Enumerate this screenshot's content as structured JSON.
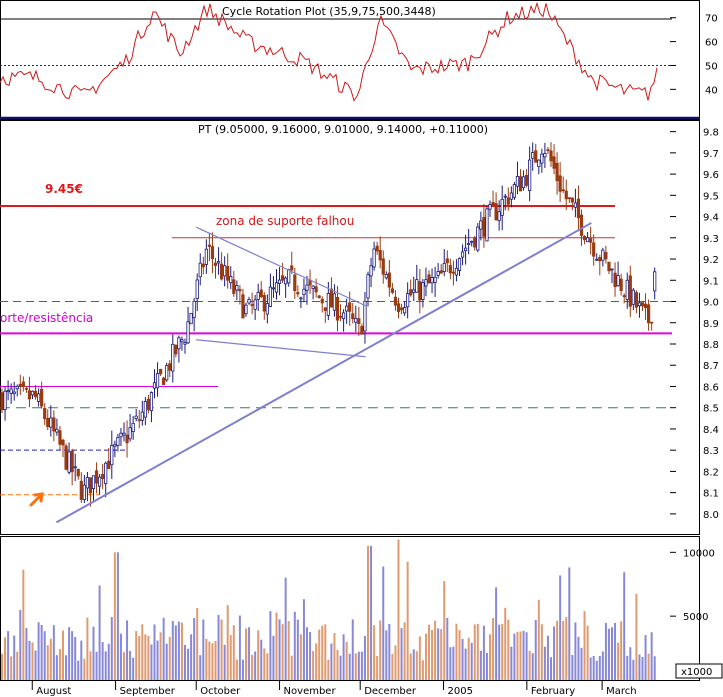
{
  "rsi_panel": {
    "header": "Cycle Rotation Plot (35,9,75,500,3448)",
    "yticks": [
      40,
      50,
      60,
      70
    ],
    "ylim": [
      28,
      77
    ],
    "ref_level": 50
  },
  "price_panel": {
    "header": "PT (9.05000, 9.16000, 9.01000, 9.14000, +0.11000)",
    "yticks": [
      "8.0",
      "8.1",
      "8.2",
      "8.3",
      "8.4",
      "8.5",
      "8.6",
      "8.7",
      "8.8",
      "8.9",
      "9.0",
      "9.1",
      "9.2",
      "9.3",
      "9.4",
      "9.5",
      "9.6",
      "9.7",
      "9.8"
    ],
    "ylim": [
      7.91,
      9.85
    ],
    "annotations": {
      "level_945": "9.45€",
      "support_failed": "zona de suporte falhou",
      "support_resistance": "orte/resistência"
    }
  },
  "volume_panel": {
    "yticks": [
      "5000",
      "10000"
    ],
    "multiplier": "x1000",
    "ylim": [
      0,
      11200
    ]
  },
  "x_axis": {
    "months": [
      "August",
      "September",
      "October",
      "November",
      "December",
      "2005",
      "February",
      "March"
    ]
  },
  "colors": {
    "up": "#1a1a80",
    "down": "#9a3a10",
    "rsi_line": "#d01818",
    "trendline": "#7f7fd0",
    "red_line": "#e01818",
    "magenta": "#e000e0",
    "resistance": "#d03030",
    "green_dash": "#308060",
    "vol_up": "#8888d8",
    "vol_down": "#e09a70",
    "arrow": "#ff7010"
  },
  "chart_data": {
    "type": "candlestick",
    "period": "Aug 2004 - Mar 2005",
    "last_bar": {
      "open": 9.05,
      "high": 9.16,
      "low": 9.01,
      "close": 9.14,
      "change": 0.11
    },
    "price_checkpoints": [
      {
        "date": "2004-08-02",
        "price": 8.55
      },
      {
        "date": "2004-08-20",
        "price": 8.1
      },
      {
        "date": "2004-09-10",
        "price": 8.45
      },
      {
        "date": "2004-09-27",
        "price": 8.85
      },
      {
        "date": "2004-10-05",
        "price": 9.25
      },
      {
        "date": "2004-10-20",
        "price": 8.95
      },
      {
        "date": "2004-11-05",
        "price": 9.1
      },
      {
        "date": "2004-11-25",
        "price": 8.95
      },
      {
        "date": "2004-12-01",
        "price": 8.85
      },
      {
        "date": "2004-12-06",
        "price": 9.25
      },
      {
        "date": "2004-12-15",
        "price": 9.0
      },
      {
        "date": "2004-12-30",
        "price": 9.1
      },
      {
        "date": "2005-01-15",
        "price": 9.35
      },
      {
        "date": "2005-02-01",
        "price": 9.6
      },
      {
        "date": "2005-02-07",
        "price": 9.75
      },
      {
        "date": "2005-02-15",
        "price": 9.5
      },
      {
        "date": "2005-03-01",
        "price": 9.2
      },
      {
        "date": "2005-03-10",
        "price": 9.05
      },
      {
        "date": "2005-03-18",
        "price": 8.9
      },
      {
        "date": "2005-03-24",
        "price": 9.14
      }
    ],
    "horizontal_levels": [
      {
        "value": 9.45,
        "label": "9.45€",
        "style": "solid-red"
      },
      {
        "value": 9.3,
        "label": "zona de suporte falhou",
        "style": "thin-red"
      },
      {
        "value": 9.0,
        "style": "magenta-dashed"
      },
      {
        "value": 8.85,
        "label": "orte/resistência",
        "style": "magenta-solid"
      },
      {
        "value": 8.6,
        "style": "magenta-short"
      },
      {
        "value": 8.5,
        "style": "green-dashed"
      },
      {
        "value": 8.3,
        "style": "blue-dashed-short"
      },
      {
        "value": 8.09,
        "style": "orange-dashed-short"
      }
    ],
    "trendlines": [
      {
        "name": "uptrend",
        "from": {
          "date": "2004-08-10",
          "price": 7.96
        },
        "to": {
          "date": "2005-02-25",
          "price": 9.37
        }
      },
      {
        "name": "wedge-top",
        "from": {
          "date": "2004-10-01",
          "price": 9.35
        },
        "to": {
          "date": "2004-12-03",
          "price": 8.98
        }
      },
      {
        "name": "wedge-bottom",
        "from": {
          "date": "2004-10-01",
          "price": 8.82
        },
        "to": {
          "date": "2004-12-03",
          "price": 8.74
        }
      }
    ],
    "rsi_checkpoints": [
      {
        "date": "2004-08-02",
        "value": 45
      },
      {
        "date": "2004-08-20",
        "value": 37
      },
      {
        "date": "2004-09-05",
        "value": 52
      },
      {
        "date": "2004-09-15",
        "value": 73
      },
      {
        "date": "2004-09-25",
        "value": 55
      },
      {
        "date": "2004-10-05",
        "value": 74
      },
      {
        "date": "2004-10-20",
        "value": 60
      },
      {
        "date": "2004-11-10",
        "value": 52
      },
      {
        "date": "2004-11-30",
        "value": 37
      },
      {
        "date": "2004-12-08",
        "value": 69
      },
      {
        "date": "2004-12-20",
        "value": 48
      },
      {
        "date": "2005-01-10",
        "value": 51
      },
      {
        "date": "2005-01-25",
        "value": 70
      },
      {
        "date": "2005-02-08",
        "value": 74
      },
      {
        "date": "2005-02-25",
        "value": 44
      },
      {
        "date": "2005-03-10",
        "value": 39
      },
      {
        "date": "2005-03-18",
        "value": 38
      },
      {
        "date": "2005-03-24",
        "value": 52
      }
    ]
  }
}
